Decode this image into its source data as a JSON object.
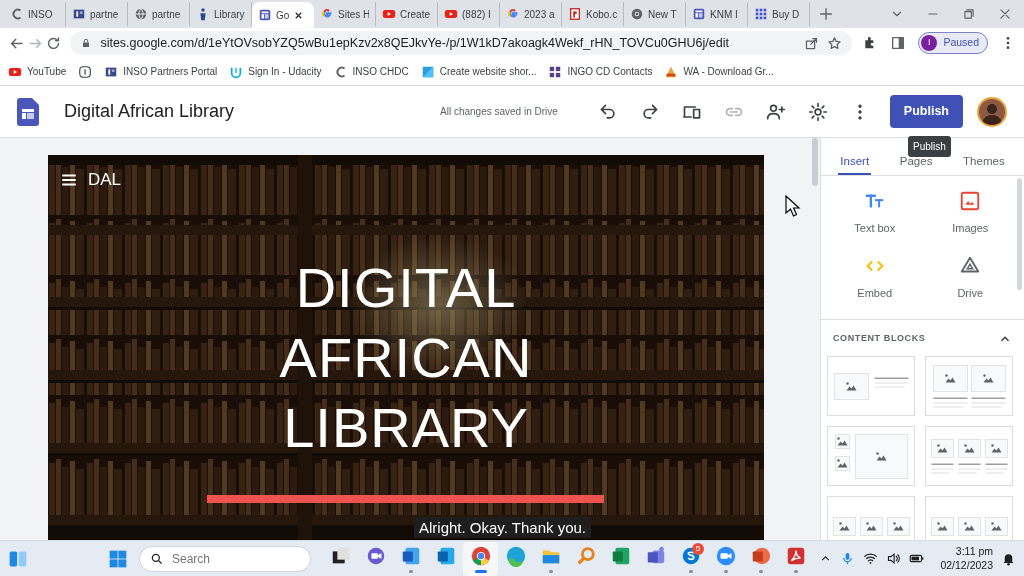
{
  "browser": {
    "tabs": [
      {
        "label": "INSO",
        "kind": "ring",
        "selected": false
      },
      {
        "label": "partne",
        "kind": "portal",
        "selected": false
      },
      {
        "label": "partne",
        "kind": "globe",
        "selected": false
      },
      {
        "label": "Library",
        "kind": "figure",
        "selected": false
      },
      {
        "label": "Go",
        "kind": "sites",
        "selected": true
      },
      {
        "label": "Sites H",
        "kind": "google",
        "selected": false
      },
      {
        "label": "Create",
        "kind": "youtube",
        "selected": false
      },
      {
        "label": "(882) I",
        "kind": "youtube",
        "selected": false
      },
      {
        "label": "2023 a",
        "kind": "google",
        "selected": false
      },
      {
        "label": "Kobo.c",
        "kind": "kobo",
        "selected": false
      },
      {
        "label": "New T",
        "kind": "chrome",
        "selected": false
      },
      {
        "label": "KNM I",
        "kind": "sites",
        "selected": false
      },
      {
        "label": "Buy D",
        "kind": "apps",
        "selected": false
      }
    ],
    "address": "sites.google.com/d/1eYtOVsobYZQ5wBu1epKzv2x8QEJkvYe-/p/1W1kD7akoagk4Wekf_rHN_TOVCu0GHU6j/edit",
    "profile": {
      "initial": "I",
      "label": "Paused"
    },
    "bookmarks": [
      {
        "label": "YouTube",
        "kind": "youtube"
      },
      {
        "kind": "bracket"
      },
      {
        "label": "INSO Partners Portal",
        "kind": "portal"
      },
      {
        "label": "Sign In - Udacity",
        "kind": "udacity"
      },
      {
        "label": "INSO CHDC",
        "kind": "ring"
      },
      {
        "label": "Create website shor...",
        "kind": "azure"
      },
      {
        "label": "INGO CD Contacts",
        "kind": "grid"
      },
      {
        "label": "WA - Download Gr...",
        "kind": "cone"
      }
    ]
  },
  "sites": {
    "title": "Digital African Library",
    "status": "All changes saved in Drive",
    "tools": [
      {
        "kind": "undo",
        "disabled": false
      },
      {
        "kind": "redo",
        "disabled": false
      },
      {
        "kind": "preview",
        "disabled": false
      },
      {
        "kind": "link",
        "disabled": true
      },
      {
        "kind": "share",
        "disabled": false
      },
      {
        "kind": "settings",
        "disabled": false
      },
      {
        "kind": "more",
        "disabled": false
      }
    ],
    "publish": "Publish",
    "tooltip": "Publish"
  },
  "hero": {
    "menu_label": "DAL",
    "title": "DIGITAL AFRICAN LIBRARY"
  },
  "panel": {
    "tabs": [
      {
        "label": "Insert",
        "selected": true
      },
      {
        "label": "Pages",
        "selected": false
      },
      {
        "label": "Themes",
        "selected": false
      }
    ],
    "items": [
      {
        "label": "Text box",
        "kind": "textbox"
      },
      {
        "label": "Images",
        "kind": "images"
      },
      {
        "label": "Embed",
        "kind": "embed"
      },
      {
        "label": "Drive",
        "kind": "drive"
      }
    ],
    "section": {
      "title": "CONTENT BLOCKS",
      "expanded": true
    },
    "blocks": [
      {
        "kind": "image-text"
      },
      {
        "kind": "two-images"
      },
      {
        "kind": "image-grid"
      },
      {
        "kind": "three-images"
      },
      {
        "kind": "image-row"
      },
      {
        "kind": "image-row"
      }
    ]
  },
  "caption": "Alright. Okay. Thank you.",
  "taskbar": {
    "search": {
      "placeholder": "Search"
    },
    "apps": [
      {
        "kind": "taskview",
        "running": false,
        "selected": false
      },
      {
        "kind": "meet",
        "running": false,
        "selected": false
      },
      {
        "kind": "word",
        "running": true,
        "selected": false
      },
      {
        "kind": "outlook",
        "running": false,
        "selected": false
      },
      {
        "kind": "chrome",
        "running": true,
        "selected": true
      },
      {
        "kind": "edge",
        "running": false,
        "selected": false
      },
      {
        "kind": "explorer",
        "running": true,
        "selected": false
      },
      {
        "kind": "finder",
        "running": false,
        "selected": false
      },
      {
        "kind": "excel",
        "running": false,
        "selected": false
      },
      {
        "kind": "teams",
        "running": false,
        "selected": false
      },
      {
        "kind": "skype",
        "running": true,
        "selected": false,
        "badge": "5"
      },
      {
        "kind": "zoom",
        "running": true,
        "selected": false
      },
      {
        "kind": "powerpoint",
        "running": true,
        "selected": false
      },
      {
        "kind": "acrobat",
        "running": true,
        "selected": false
      }
    ],
    "time": "3:11 pm",
    "date": "02/12/2023"
  }
}
